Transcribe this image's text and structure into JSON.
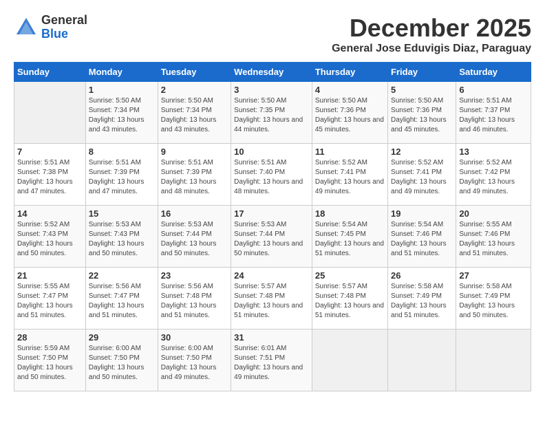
{
  "header": {
    "logo_general": "General",
    "logo_blue": "Blue",
    "main_title": "December 2025",
    "subtitle": "General Jose Eduvigis Diaz, Paraguay"
  },
  "columns": [
    "Sunday",
    "Monday",
    "Tuesday",
    "Wednesday",
    "Thursday",
    "Friday",
    "Saturday"
  ],
  "weeks": [
    [
      {
        "day": "",
        "sunrise": "",
        "sunset": "",
        "daylight": ""
      },
      {
        "day": "1",
        "sunrise": "Sunrise: 5:50 AM",
        "sunset": "Sunset: 7:34 PM",
        "daylight": "Daylight: 13 hours and 43 minutes."
      },
      {
        "day": "2",
        "sunrise": "Sunrise: 5:50 AM",
        "sunset": "Sunset: 7:34 PM",
        "daylight": "Daylight: 13 hours and 43 minutes."
      },
      {
        "day": "3",
        "sunrise": "Sunrise: 5:50 AM",
        "sunset": "Sunset: 7:35 PM",
        "daylight": "Daylight: 13 hours and 44 minutes."
      },
      {
        "day": "4",
        "sunrise": "Sunrise: 5:50 AM",
        "sunset": "Sunset: 7:36 PM",
        "daylight": "Daylight: 13 hours and 45 minutes."
      },
      {
        "day": "5",
        "sunrise": "Sunrise: 5:50 AM",
        "sunset": "Sunset: 7:36 PM",
        "daylight": "Daylight: 13 hours and 45 minutes."
      },
      {
        "day": "6",
        "sunrise": "Sunrise: 5:51 AM",
        "sunset": "Sunset: 7:37 PM",
        "daylight": "Daylight: 13 hours and 46 minutes."
      }
    ],
    [
      {
        "day": "7",
        "sunrise": "Sunrise: 5:51 AM",
        "sunset": "Sunset: 7:38 PM",
        "daylight": "Daylight: 13 hours and 47 minutes."
      },
      {
        "day": "8",
        "sunrise": "Sunrise: 5:51 AM",
        "sunset": "Sunset: 7:39 PM",
        "daylight": "Daylight: 13 hours and 47 minutes."
      },
      {
        "day": "9",
        "sunrise": "Sunrise: 5:51 AM",
        "sunset": "Sunset: 7:39 PM",
        "daylight": "Daylight: 13 hours and 48 minutes."
      },
      {
        "day": "10",
        "sunrise": "Sunrise: 5:51 AM",
        "sunset": "Sunset: 7:40 PM",
        "daylight": "Daylight: 13 hours and 48 minutes."
      },
      {
        "day": "11",
        "sunrise": "Sunrise: 5:52 AM",
        "sunset": "Sunset: 7:41 PM",
        "daylight": "Daylight: 13 hours and 49 minutes."
      },
      {
        "day": "12",
        "sunrise": "Sunrise: 5:52 AM",
        "sunset": "Sunset: 7:41 PM",
        "daylight": "Daylight: 13 hours and 49 minutes."
      },
      {
        "day": "13",
        "sunrise": "Sunrise: 5:52 AM",
        "sunset": "Sunset: 7:42 PM",
        "daylight": "Daylight: 13 hours and 49 minutes."
      }
    ],
    [
      {
        "day": "14",
        "sunrise": "Sunrise: 5:52 AM",
        "sunset": "Sunset: 7:43 PM",
        "daylight": "Daylight: 13 hours and 50 minutes."
      },
      {
        "day": "15",
        "sunrise": "Sunrise: 5:53 AM",
        "sunset": "Sunset: 7:43 PM",
        "daylight": "Daylight: 13 hours and 50 minutes."
      },
      {
        "day": "16",
        "sunrise": "Sunrise: 5:53 AM",
        "sunset": "Sunset: 7:44 PM",
        "daylight": "Daylight: 13 hours and 50 minutes."
      },
      {
        "day": "17",
        "sunrise": "Sunrise: 5:53 AM",
        "sunset": "Sunset: 7:44 PM",
        "daylight": "Daylight: 13 hours and 50 minutes."
      },
      {
        "day": "18",
        "sunrise": "Sunrise: 5:54 AM",
        "sunset": "Sunset: 7:45 PM",
        "daylight": "Daylight: 13 hours and 51 minutes."
      },
      {
        "day": "19",
        "sunrise": "Sunrise: 5:54 AM",
        "sunset": "Sunset: 7:46 PM",
        "daylight": "Daylight: 13 hours and 51 minutes."
      },
      {
        "day": "20",
        "sunrise": "Sunrise: 5:55 AM",
        "sunset": "Sunset: 7:46 PM",
        "daylight": "Daylight: 13 hours and 51 minutes."
      }
    ],
    [
      {
        "day": "21",
        "sunrise": "Sunrise: 5:55 AM",
        "sunset": "Sunset: 7:47 PM",
        "daylight": "Daylight: 13 hours and 51 minutes."
      },
      {
        "day": "22",
        "sunrise": "Sunrise: 5:56 AM",
        "sunset": "Sunset: 7:47 PM",
        "daylight": "Daylight: 13 hours and 51 minutes."
      },
      {
        "day": "23",
        "sunrise": "Sunrise: 5:56 AM",
        "sunset": "Sunset: 7:48 PM",
        "daylight": "Daylight: 13 hours and 51 minutes."
      },
      {
        "day": "24",
        "sunrise": "Sunrise: 5:57 AM",
        "sunset": "Sunset: 7:48 PM",
        "daylight": "Daylight: 13 hours and 51 minutes."
      },
      {
        "day": "25",
        "sunrise": "Sunrise: 5:57 AM",
        "sunset": "Sunset: 7:48 PM",
        "daylight": "Daylight: 13 hours and 51 minutes."
      },
      {
        "day": "26",
        "sunrise": "Sunrise: 5:58 AM",
        "sunset": "Sunset: 7:49 PM",
        "daylight": "Daylight: 13 hours and 51 minutes."
      },
      {
        "day": "27",
        "sunrise": "Sunrise: 5:58 AM",
        "sunset": "Sunset: 7:49 PM",
        "daylight": "Daylight: 13 hours and 50 minutes."
      }
    ],
    [
      {
        "day": "28",
        "sunrise": "Sunrise: 5:59 AM",
        "sunset": "Sunset: 7:50 PM",
        "daylight": "Daylight: 13 hours and 50 minutes."
      },
      {
        "day": "29",
        "sunrise": "Sunrise: 6:00 AM",
        "sunset": "Sunset: 7:50 PM",
        "daylight": "Daylight: 13 hours and 50 minutes."
      },
      {
        "day": "30",
        "sunrise": "Sunrise: 6:00 AM",
        "sunset": "Sunset: 7:50 PM",
        "daylight": "Daylight: 13 hours and 49 minutes."
      },
      {
        "day": "31",
        "sunrise": "Sunrise: 6:01 AM",
        "sunset": "Sunset: 7:51 PM",
        "daylight": "Daylight: 13 hours and 49 minutes."
      },
      {
        "day": "",
        "sunrise": "",
        "sunset": "",
        "daylight": ""
      },
      {
        "day": "",
        "sunrise": "",
        "sunset": "",
        "daylight": ""
      },
      {
        "day": "",
        "sunrise": "",
        "sunset": "",
        "daylight": ""
      }
    ]
  ]
}
